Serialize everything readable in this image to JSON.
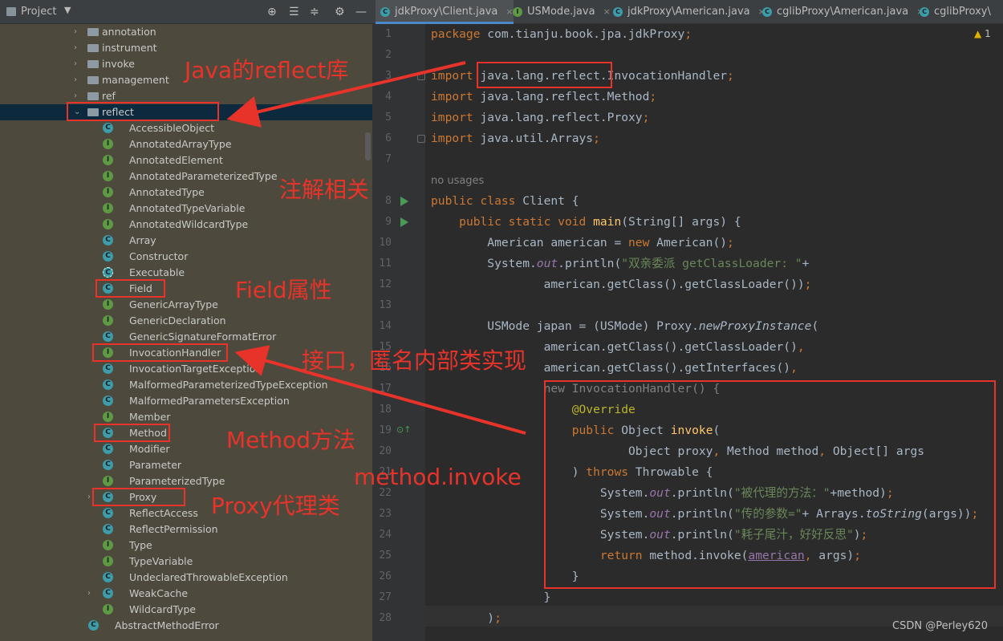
{
  "project": {
    "title": "Project",
    "dropdown": "▼"
  },
  "toolbar_icons": [
    "target-icon",
    "collapse-icon",
    "expand-icon",
    "gear-icon",
    "minimize-icon"
  ],
  "tree": [
    {
      "label": "annotation",
      "type": "folder",
      "indent": 1,
      "arrow": "›"
    },
    {
      "label": "instrument",
      "type": "folder",
      "indent": 1,
      "arrow": "›"
    },
    {
      "label": "invoke",
      "type": "folder",
      "indent": 1,
      "arrow": "›"
    },
    {
      "label": "management",
      "type": "folder",
      "indent": 1,
      "arrow": "›"
    },
    {
      "label": "ref",
      "type": "folder",
      "indent": 1,
      "arrow": "›"
    },
    {
      "label": "reflect",
      "type": "folder",
      "indent": 1,
      "arrow": "⌄",
      "selected": true
    },
    {
      "label": "AccessibleObject",
      "type": "c",
      "indent": 2
    },
    {
      "label": "AnnotatedArrayType",
      "type": "i",
      "indent": 2
    },
    {
      "label": "AnnotatedElement",
      "type": "i",
      "indent": 2
    },
    {
      "label": "AnnotatedParameterizedType",
      "type": "i",
      "indent": 2
    },
    {
      "label": "AnnotatedType",
      "type": "i",
      "indent": 2
    },
    {
      "label": "AnnotatedTypeVariable",
      "type": "i",
      "indent": 2
    },
    {
      "label": "AnnotatedWildcardType",
      "type": "i",
      "indent": 2
    },
    {
      "label": "Array",
      "type": "c",
      "indent": 2
    },
    {
      "label": "Constructor",
      "type": "c",
      "indent": 2
    },
    {
      "label": "Executable",
      "type": "a",
      "indent": 2
    },
    {
      "label": "Field",
      "type": "c",
      "indent": 2
    },
    {
      "label": "GenericArrayType",
      "type": "i",
      "indent": 2
    },
    {
      "label": "GenericDeclaration",
      "type": "i",
      "indent": 2
    },
    {
      "label": "GenericSignatureFormatError",
      "type": "c",
      "indent": 2
    },
    {
      "label": "InvocationHandler",
      "type": "i",
      "indent": 2
    },
    {
      "label": "InvocationTargetException",
      "type": "c",
      "indent": 2
    },
    {
      "label": "MalformedParameterizedTypeException",
      "type": "c",
      "indent": 2
    },
    {
      "label": "MalformedParametersException",
      "type": "c",
      "indent": 2
    },
    {
      "label": "Member",
      "type": "i",
      "indent": 2
    },
    {
      "label": "Method",
      "type": "c",
      "indent": 2
    },
    {
      "label": "Modifier",
      "type": "c",
      "indent": 2
    },
    {
      "label": "Parameter",
      "type": "c",
      "indent": 2
    },
    {
      "label": "ParameterizedType",
      "type": "i",
      "indent": 2
    },
    {
      "label": "Proxy",
      "type": "c",
      "indent": 2,
      "arrow": "›"
    },
    {
      "label": "ReflectAccess",
      "type": "c",
      "indent": 2
    },
    {
      "label": "ReflectPermission",
      "type": "c",
      "indent": 2
    },
    {
      "label": "Type",
      "type": "i",
      "indent": 2
    },
    {
      "label": "TypeVariable",
      "type": "i",
      "indent": 2
    },
    {
      "label": "UndeclaredThrowableException",
      "type": "c",
      "indent": 2
    },
    {
      "label": "WeakCache",
      "type": "c",
      "indent": 2,
      "arrow": "›"
    },
    {
      "label": "WildcardType",
      "type": "i",
      "indent": 2
    },
    {
      "label": "AbstractMethodError",
      "type": "c",
      "indent": 0
    }
  ],
  "tabs": [
    {
      "label": "jdkProxy\\Client.java",
      "active": true,
      "icon": "C",
      "color": "#3c9caa",
      "close": "×"
    },
    {
      "label": "USMode.java",
      "active": false,
      "icon": "I",
      "color": "#5e9a44",
      "close": "×"
    },
    {
      "label": "jdkProxy\\American.java",
      "active": false,
      "icon": "C",
      "color": "#3c9caa",
      "close": "×"
    },
    {
      "label": "cglibProxy\\American.java",
      "active": false,
      "icon": "C",
      "color": "#3c9caa",
      "close": "×"
    },
    {
      "label": "cglibProxy\\",
      "active": false,
      "icon": "C",
      "color": "#3c9caa",
      "close": ""
    }
  ],
  "inspection": {
    "icon": "▲",
    "count": "1"
  },
  "line_numbers": [
    "1",
    "2",
    "3",
    "4",
    "5",
    "6",
    "7",
    "",
    "8",
    "9",
    "10",
    "11",
    "12",
    "13",
    "14",
    "15",
    "16",
    "17",
    "18",
    "19",
    "20",
    "21",
    "22",
    "23",
    "24",
    "25",
    "26",
    "27",
    "28"
  ],
  "code_lines": [
    [
      [
        "k",
        "package "
      ],
      [
        "",
        "com.tianju.book.jpa.jdkProxy"
      ],
      [
        "k",
        ";"
      ]
    ],
    [],
    [
      [
        "k",
        "import "
      ],
      [
        "",
        "java.lang.reflect.InvocationHandler"
      ],
      [
        "k",
        ";"
      ]
    ],
    [
      [
        "k",
        "import "
      ],
      [
        "",
        "java.lang.reflect.Method"
      ],
      [
        "k",
        ";"
      ]
    ],
    [
      [
        "k",
        "import "
      ],
      [
        "",
        "java.lang.reflect.Proxy"
      ],
      [
        "k",
        ";"
      ]
    ],
    [
      [
        "k",
        "import "
      ],
      [
        "",
        "java.util.Arrays"
      ],
      [
        "k",
        ";"
      ]
    ],
    [],
    [
      [
        "gr",
        "no usages"
      ]
    ],
    [
      [
        "k",
        "public class "
      ],
      [
        "",
        "Client {"
      ]
    ],
    [
      [
        "",
        "    "
      ],
      [
        "k",
        "public static void "
      ],
      [
        "f",
        "main"
      ],
      [
        "",
        "(String[] args) {"
      ]
    ],
    [
      [
        "",
        "        American american = "
      ],
      [
        "k",
        "new "
      ],
      [
        "",
        "American()"
      ],
      [
        "k",
        ";"
      ]
    ],
    [
      [
        "",
        "        System."
      ],
      [
        "st",
        "out"
      ],
      [
        "",
        ".println("
      ],
      [
        "s",
        "\"双亲委派 getClassLoader: \""
      ],
      [
        "",
        "+"
      ]
    ],
    [
      [
        "",
        "                american.getClass().getClassLoader())"
      ],
      [
        "k",
        ";"
      ]
    ],
    [],
    [
      [
        "",
        "        USMode japan = (USMode) Proxy."
      ],
      [
        "it",
        "newProxyInstance"
      ],
      [
        "",
        "("
      ]
    ],
    [
      [
        "",
        "                american.getClass().getClassLoader()"
      ],
      [
        "k",
        ","
      ]
    ],
    [
      [
        "",
        "                american.getClass().getInterfaces()"
      ],
      [
        "k",
        ","
      ]
    ],
    [
      [
        "dim",
        "                new InvocationHandler() {"
      ]
    ],
    [
      [
        "",
        "                    "
      ],
      [
        "an",
        "@Override"
      ]
    ],
    [
      [
        "",
        "                    "
      ],
      [
        "k",
        "public "
      ],
      [
        "",
        "Object "
      ],
      [
        "f",
        "invoke"
      ],
      [
        "",
        "("
      ]
    ],
    [
      [
        "",
        "                            Object proxy"
      ],
      [
        "k",
        ", "
      ],
      [
        "",
        "Method method"
      ],
      [
        "k",
        ", "
      ],
      [
        "",
        "Object[] args"
      ]
    ],
    [
      [
        "",
        "                    ) "
      ],
      [
        "k",
        "throws "
      ],
      [
        "",
        "Throwable {"
      ]
    ],
    [
      [
        "",
        "                        System."
      ],
      [
        "st",
        "out"
      ],
      [
        "",
        ".println("
      ],
      [
        "s",
        "\"被代理的方法：\""
      ],
      [
        "",
        "+method)"
      ],
      [
        "k",
        ";"
      ]
    ],
    [
      [
        "",
        "                        System."
      ],
      [
        "st",
        "out"
      ],
      [
        "",
        ".println("
      ],
      [
        "s",
        "\"传的参数=\""
      ],
      [
        "",
        "+ Arrays."
      ],
      [
        "it",
        "toString"
      ],
      [
        "",
        "(args))"
      ],
      [
        "k",
        ";"
      ]
    ],
    [
      [
        "",
        "                        System."
      ],
      [
        "st",
        "out"
      ],
      [
        "",
        ".println("
      ],
      [
        "s",
        "\"耗子尾汁，好好反思\""
      ],
      [
        "",
        ")"
      ],
      [
        "k",
        ";"
      ]
    ],
    [
      [
        "",
        "                        "
      ],
      [
        "k",
        "return "
      ],
      [
        "",
        "method.invoke("
      ],
      [
        "ul",
        "american"
      ],
      [
        "k",
        ", "
      ],
      [
        "",
        "args)"
      ],
      [
        "k",
        ";"
      ]
    ],
    [
      [
        "",
        "                    }"
      ]
    ],
    [
      [
        "",
        "                }"
      ]
    ],
    [
      [
        "",
        "        )"
      ],
      [
        "k",
        ";"
      ]
    ]
  ],
  "annotations": [
    {
      "text": "Java的reflect库"
    },
    {
      "text": "注解相关"
    },
    {
      "text": "Field属性"
    },
    {
      "text": "接口，匿名内部类实现"
    },
    {
      "text": "Method方法"
    },
    {
      "text": "method.invoke"
    },
    {
      "text": "Proxy代理类"
    }
  ],
  "watermark": "CSDN @Perley620",
  "colors": {
    "annotation_red": "#e8332a",
    "keyword": "#cc7832",
    "string": "#6a8759",
    "method": "#ffc66d",
    "static_field": "#9876aa"
  }
}
